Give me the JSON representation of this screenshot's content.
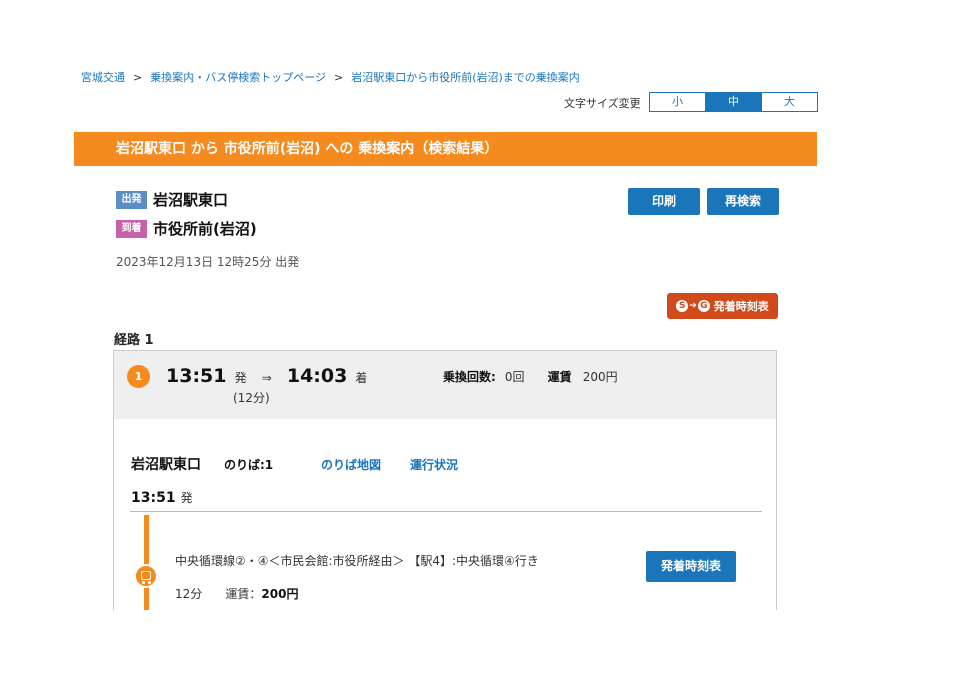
{
  "breadcrumb": {
    "items": [
      "宮城交通",
      "乗換案内・バス停検索トップページ",
      "岩沼駅東口から市役所前(岩沼)までの乗換案内"
    ],
    "separator": ">"
  },
  "font_size": {
    "label": "文字サイズ変更",
    "options": [
      "小",
      "中",
      "大"
    ],
    "selected": "中"
  },
  "banner": {
    "title": "岩沼駅東口 から 市役所前(岩沼) への 乗換案内（検索結果）"
  },
  "trip": {
    "departure_tag": "出発",
    "departure": "岩沼駅東口",
    "arrival_tag": "到着",
    "arrival": "市役所前(岩沼)",
    "datetime": "2023年12月13日 12時25分 出発"
  },
  "actions": {
    "print": "印刷",
    "research": "再検索"
  },
  "timetable_link": {
    "icon_s": "S",
    "icon_g": "G",
    "label": "発着時刻表"
  },
  "route": {
    "title": "経路 1",
    "number": "1",
    "dep_time": "13:51",
    "dep_suffix": "発",
    "arrow": "⇒",
    "arr_time": "14:03",
    "arr_suffix": "着",
    "duration": "(12分)",
    "transfers_label": "乗換回数:",
    "transfers_value": "0回",
    "fare_label": "運賃",
    "fare_value": "200円",
    "stop": {
      "name": "岩沼駅東口",
      "platform": "のりば:1",
      "map_link": "のりば地図",
      "status_link": "運行状況",
      "time": "13:51",
      "time_suffix": "発"
    },
    "segment": {
      "line": "中央循環線②・④＜市民会館:市役所経由＞ 【駅4】:中央循環④行き",
      "duration": "12分",
      "fare_label": "運賃：",
      "fare_value": "200円",
      "timetable_button": "発着時刻表"
    }
  },
  "colors": {
    "accent_orange": "#f58a1f",
    "link_blue": "#1b75bb",
    "timetable_red": "#d14a1c",
    "departure_tag": "#5b8fc4",
    "arrival_tag": "#c961a9"
  }
}
